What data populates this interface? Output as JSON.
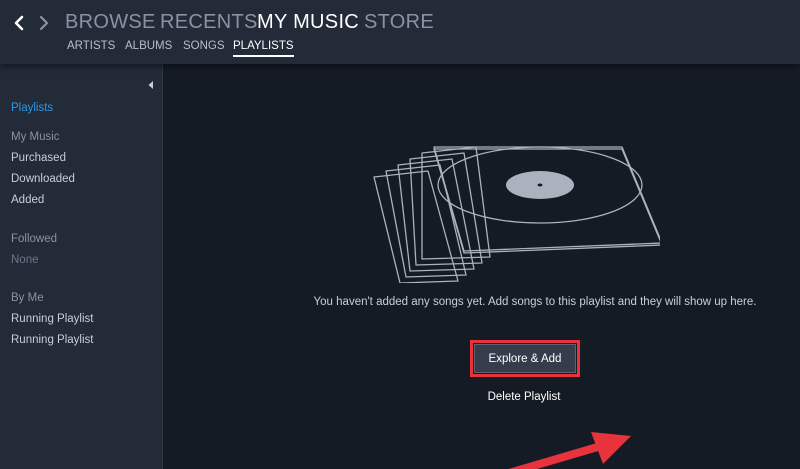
{
  "header": {
    "back_icon": "chevron-left-icon",
    "forward_icon": "chevron-right-icon",
    "main_tabs": [
      {
        "label": "BROWSE",
        "active": false
      },
      {
        "label": "RECENTS",
        "active": false
      },
      {
        "label": "MY MUSIC",
        "active": true
      },
      {
        "label": "STORE",
        "active": false
      }
    ],
    "sub_tabs": [
      {
        "label": "ARTISTS",
        "active": false
      },
      {
        "label": "ALBUMS",
        "active": false
      },
      {
        "label": "SONGS",
        "active": false
      },
      {
        "label": "PLAYLISTS",
        "active": true
      }
    ]
  },
  "sidebar": {
    "collapse_icon": "triangle-left-icon",
    "active_item": "Playlists",
    "sections": [
      {
        "heading": "My Music",
        "items": [
          "Purchased",
          "Downloaded",
          "Added"
        ]
      },
      {
        "heading": "Followed",
        "items": [
          "None"
        ]
      },
      {
        "heading": "By Me",
        "items": [
          "Running Playlist",
          "Running Playlist"
        ]
      }
    ]
  },
  "main": {
    "illustration": "vinyl-records-icon",
    "empty_message": "You haven't added any songs yet. Add songs to this playlist and they will show up here.",
    "explore_button": "Explore & Add",
    "delete_link": "Delete Playlist",
    "annotation": "red-arrow-icon"
  },
  "colors": {
    "topbar": "#232a38",
    "sidebar": "#232a38",
    "content": "#151b25",
    "accent_blue": "#2b9ae8",
    "highlight_red": "#e8323c"
  }
}
